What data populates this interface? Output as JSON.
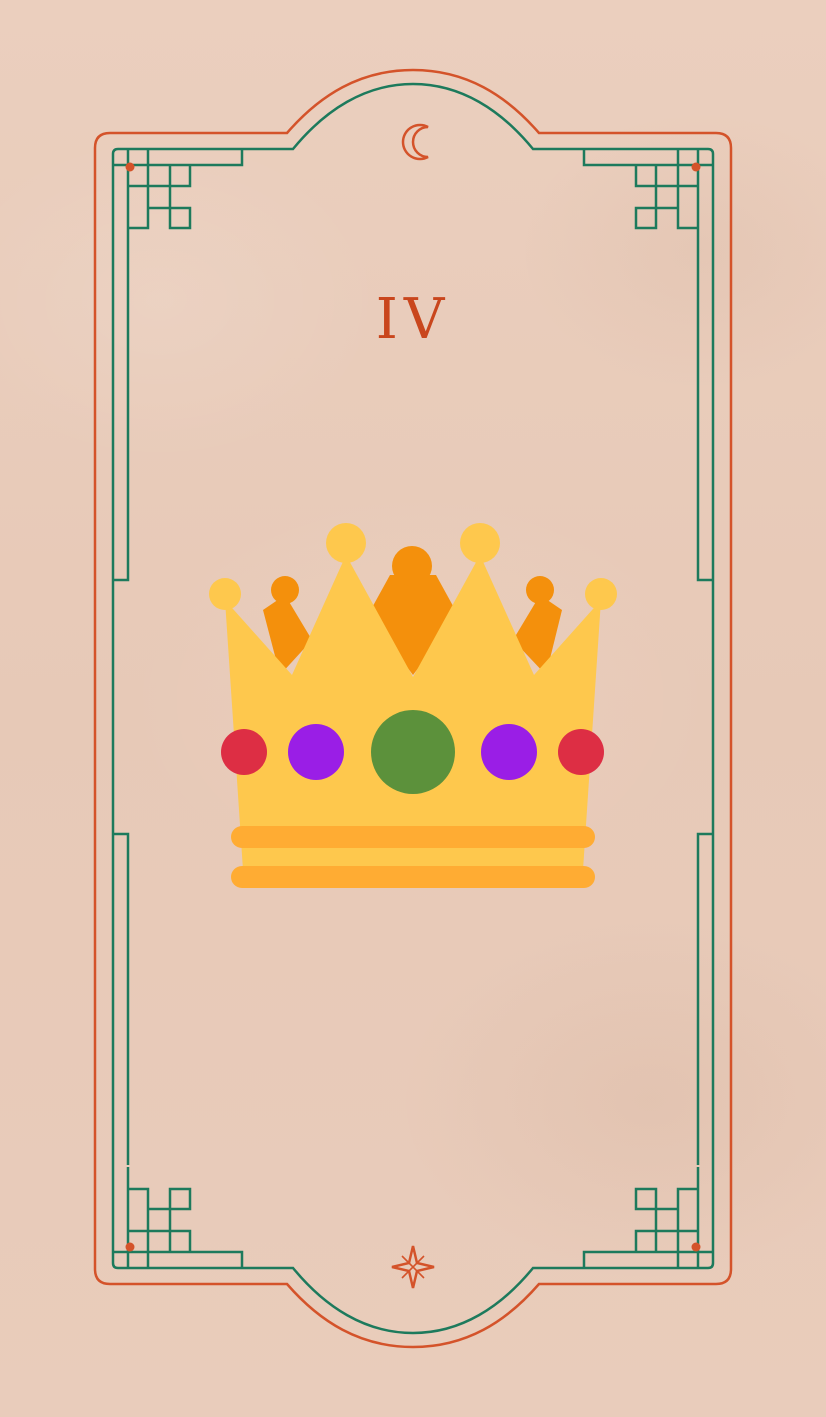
{
  "card": {
    "numeral": "IV",
    "top_symbol": "crescent-moon-icon",
    "bottom_symbol": "sparkle-star-icon",
    "illustration": "crown-icon"
  },
  "colors": {
    "background": "#e9ccbb",
    "frame_outer": "#d4532a",
    "frame_inner": "#1d7a5c",
    "numeral": "#c9461d",
    "crown_gold": "#fec84d",
    "crown_orange": "#f4900c",
    "crown_band": "#ffac33",
    "gem_red": "#dd2e44",
    "gem_purple": "#9a1ee6",
    "gem_green": "#5c913b"
  }
}
